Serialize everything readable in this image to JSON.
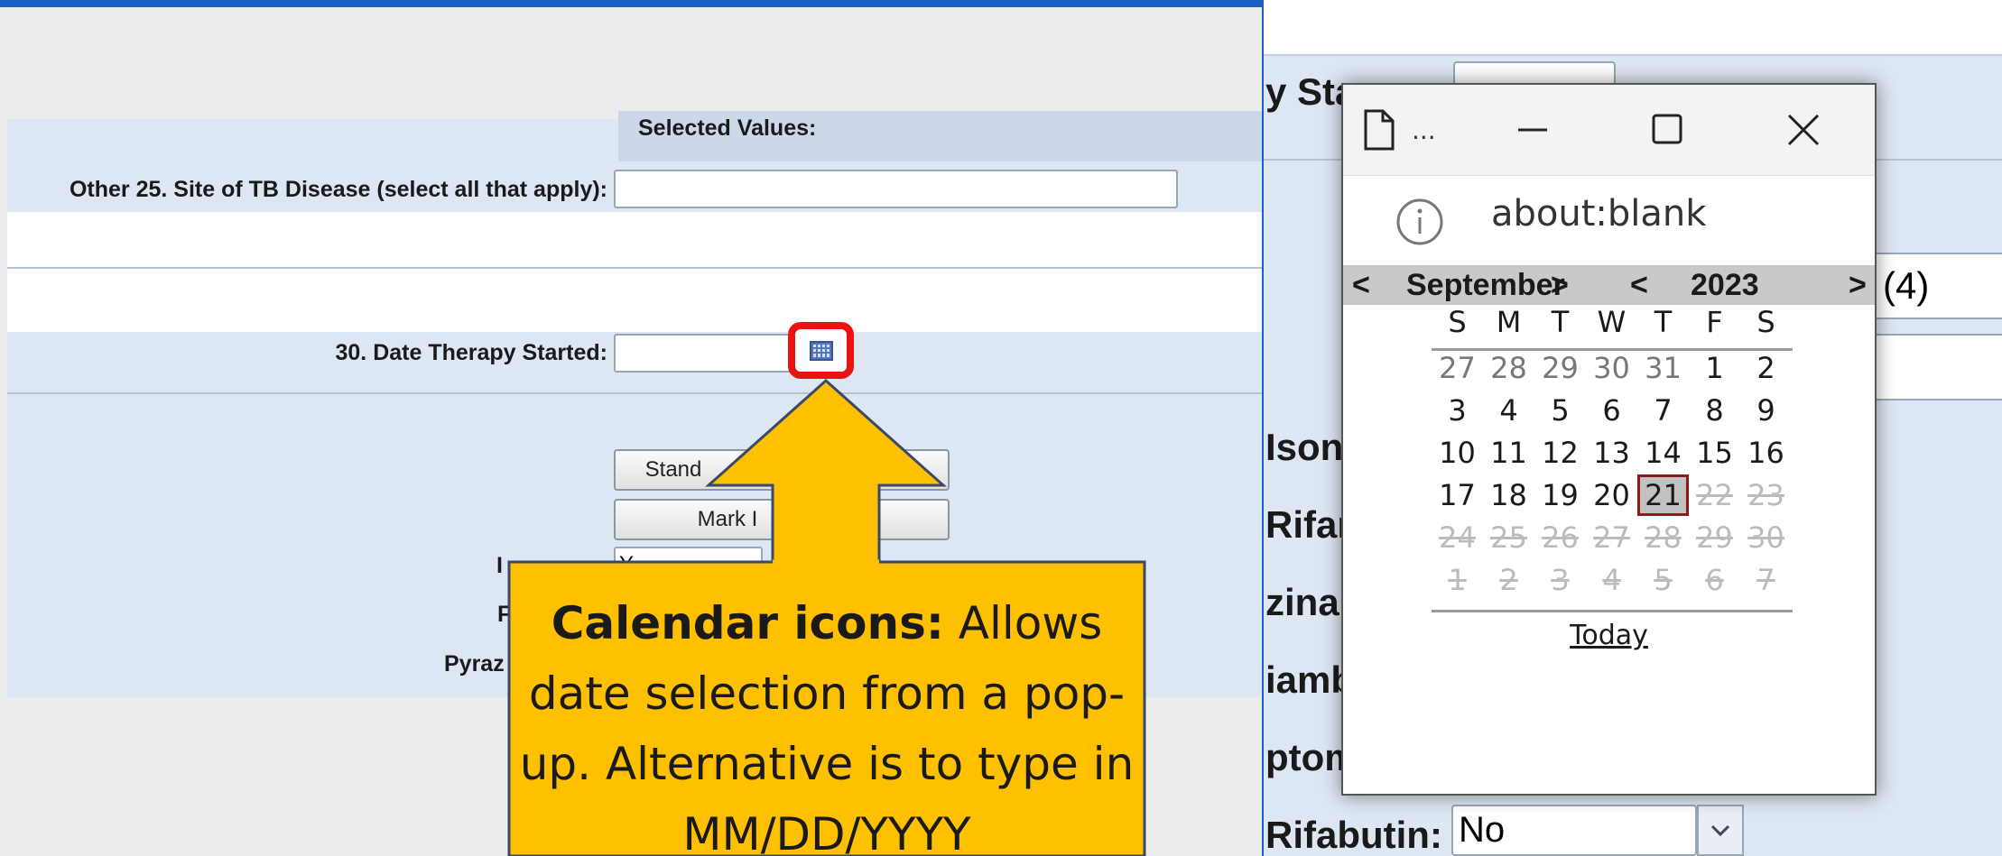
{
  "form": {
    "selected_values_label": "Selected Values:",
    "site_label": "Other 25. Site of TB Disease (select all that apply):",
    "site_value": "",
    "therapy_label": "30. Date Therapy Started:",
    "therapy_value": "",
    "buttons": [
      "Stand",
      "Mark I"
    ],
    "partial_labels": [
      "I",
      "F",
      "Pyraz"
    ],
    "isoniazid_partial_value": "Y"
  },
  "callout": {
    "bold": "Calendar icons:",
    "text": "Allows date selection from a pop-up. Alternative is to type in MM/DD/YYYY"
  },
  "right_form": {
    "labels": [
      "y Sta",
      "Isoni",
      "Rifar",
      "zinar",
      "iamb",
      "ptom",
      "Rifabutin:"
    ],
    "count_badge": "(4)",
    "rifabutin_value": "No"
  },
  "popup": {
    "title": "...",
    "address": "about:blank",
    "month_prev": "<",
    "month": "September",
    "month_next": ">",
    "year_prev": "<",
    "year": "2023",
    "year_next": ">",
    "weekdays": [
      "S",
      "M",
      "T",
      "W",
      "T",
      "F",
      "S"
    ],
    "weeks": [
      [
        "27",
        "28",
        "29",
        "30",
        "31",
        "1",
        "2"
      ],
      [
        "3",
        "4",
        "5",
        "6",
        "7",
        "8",
        "9"
      ],
      [
        "10",
        "11",
        "12",
        "13",
        "14",
        "15",
        "16"
      ],
      [
        "17",
        "18",
        "19",
        "20",
        "21",
        "22",
        "23"
      ],
      [
        "24",
        "25",
        "26",
        "27",
        "28",
        "29",
        "30"
      ],
      [
        "1",
        "2",
        "3",
        "4",
        "5",
        "6",
        "7"
      ]
    ],
    "selected_day": "21",
    "today_label": "Today"
  },
  "colors": {
    "accent_blue": "#1b5fc1",
    "form_band": "#dde6f3",
    "callout_fill": "#ffc000",
    "highlight_red": "#ee1111"
  }
}
